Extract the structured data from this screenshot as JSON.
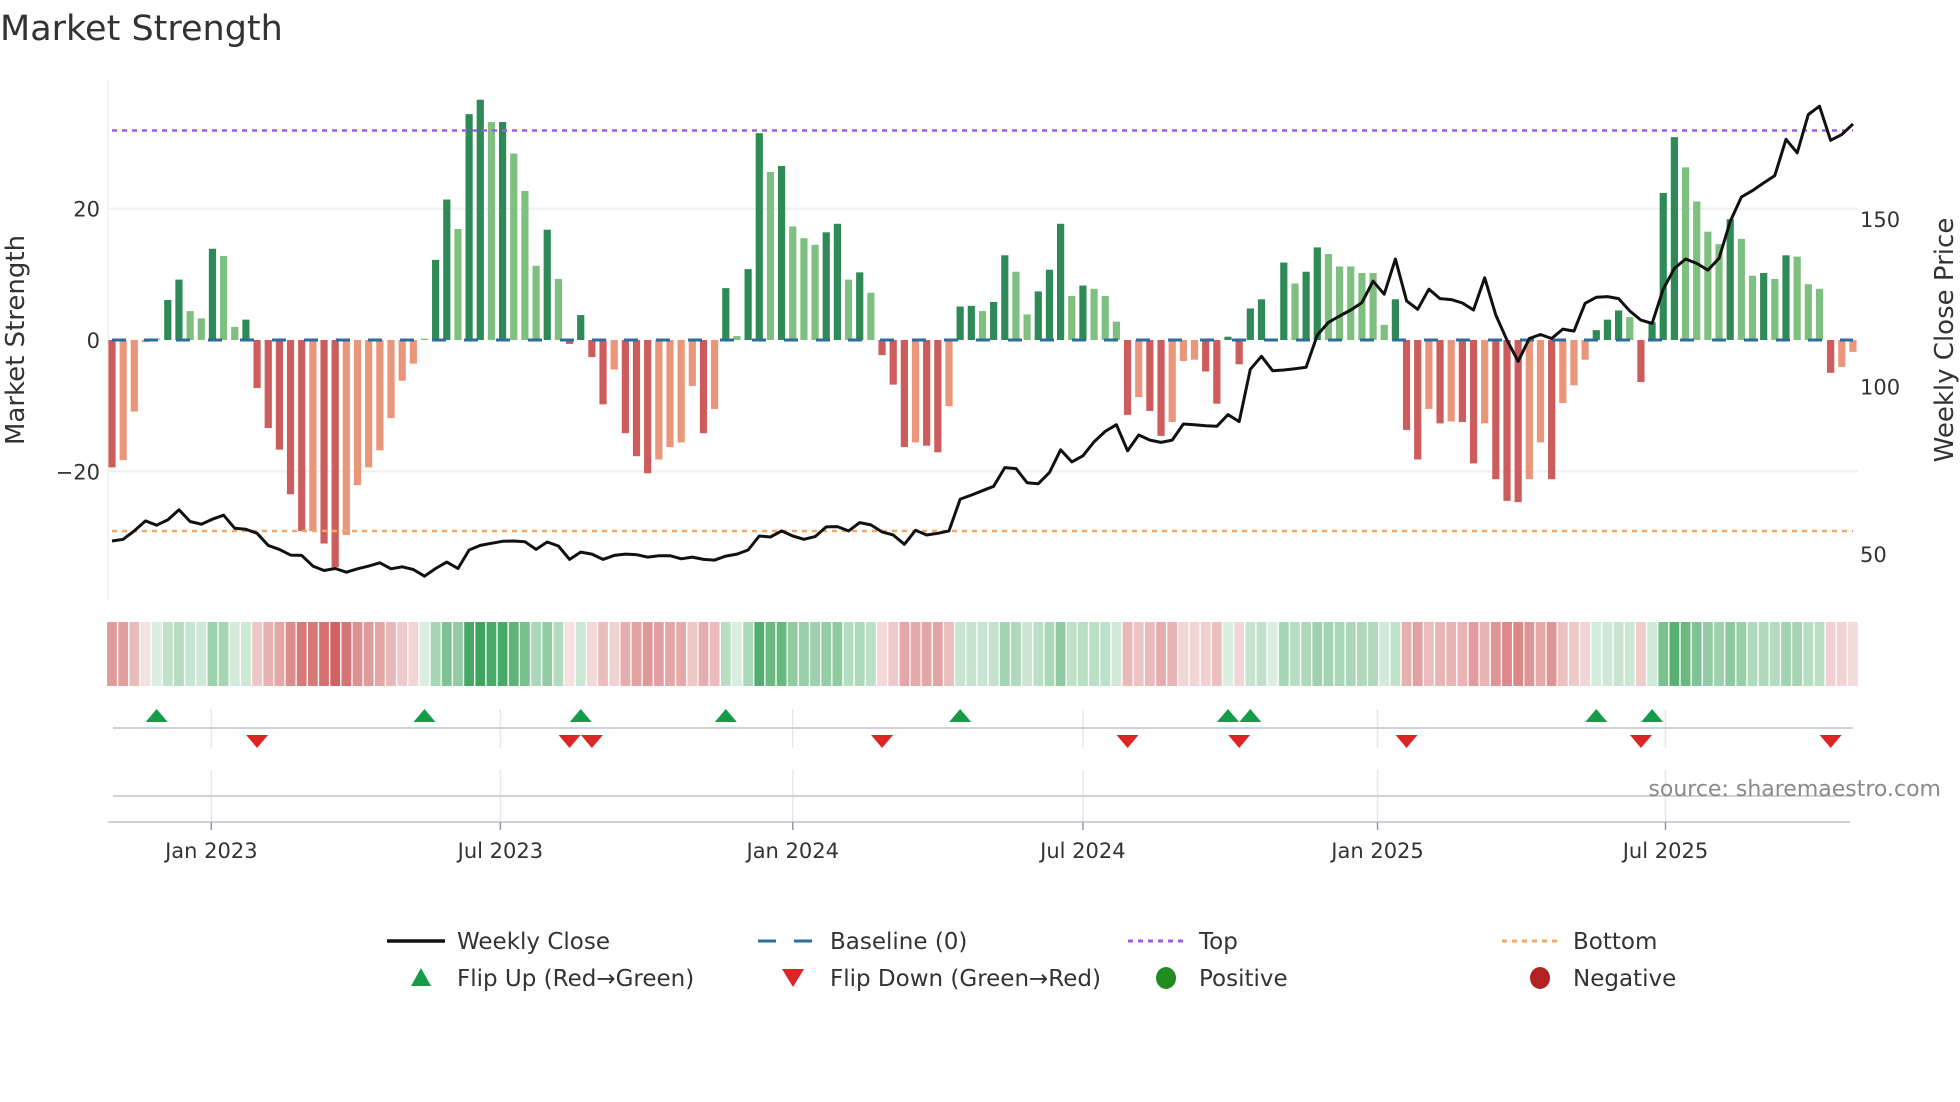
{
  "title": "Market Strength",
  "source": "source: sharemaestro.com",
  "chart_data": {
    "type": "bar",
    "title": "Market Strength",
    "ylabel": "Market Strength",
    "y2label": "Weekly Close Price",
    "ylim": [
      -39.6,
      39.6
    ],
    "y2lim": [
      36.3,
      191.4
    ],
    "y_ticks": [
      {
        "v": 20,
        "label": "20"
      },
      {
        "v": 0,
        "label": "0"
      },
      {
        "v": -20,
        "label": "−20"
      }
    ],
    "y2_ticks": [
      {
        "v": 150,
        "label": "150"
      },
      {
        "v": 100,
        "label": "100"
      },
      {
        "v": 50,
        "label": "50"
      }
    ],
    "x_ticks": [
      {
        "week": 8.9,
        "label": "Jan 2023"
      },
      {
        "week": 34.8,
        "label": "Jul 2023"
      },
      {
        "week": 61.0,
        "label": "Jan 2024"
      },
      {
        "week": 87.0,
        "label": "Jul 2024"
      },
      {
        "week": 113.4,
        "label": "Jan 2025"
      },
      {
        "week": 139.2,
        "label": "Jul 2025"
      }
    ],
    "top": 31.9,
    "bottom": -29.1,
    "baseline": 0,
    "strength": [
      -19.4,
      -18.3,
      -10.9,
      -0.3,
      0.2,
      6.1,
      9.2,
      4.4,
      3.3,
      13.9,
      12.8,
      2.0,
      3.1,
      -7.3,
      -13.4,
      -16.7,
      -23.5,
      -29.1,
      -29.1,
      -31.0,
      -34.6,
      -29.7,
      -22.1,
      -19.4,
      -16.8,
      -11.9,
      -6.2,
      -3.6,
      0.2,
      12.2,
      21.4,
      16.9,
      34.4,
      36.6,
      33.2,
      33.2,
      28.4,
      22.7,
      11.3,
      16.8,
      9.3,
      -0.6,
      3.8,
      -2.6,
      -9.8,
      -4.5,
      -14.2,
      -17.7,
      -20.3,
      -18.2,
      -16.3,
      -15.6,
      -7.0,
      -14.2,
      -10.5,
      7.9,
      0.6,
      10.8,
      31.5,
      25.6,
      26.5,
      17.3,
      15.5,
      14.5,
      16.4,
      17.7,
      9.2,
      10.3,
      7.2,
      -2.3,
      -6.8,
      -16.3,
      -15.6,
      -16.1,
      -17.1,
      -10.1,
      5.1,
      5.2,
      4.4,
      5.8,
      12.9,
      10.4,
      3.9,
      7.4,
      10.7,
      17.7,
      6.7,
      8.3,
      7.8,
      6.7,
      2.8,
      -11.4,
      -8.7,
      -10.8,
      -14.6,
      -12.5,
      -3.2,
      -3.0,
      -4.8,
      -9.7,
      0.5,
      -3.7,
      4.8,
      6.2,
      0.2,
      11.8,
      8.6,
      10.4,
      14.1,
      13.1,
      11.2,
      11.2,
      10.2,
      10.2,
      2.3,
      6.2,
      -13.7,
      -18.2,
      -10.5,
      -12.7,
      -12.4,
      -12.5,
      -18.8,
      -12.7,
      -21.2,
      -24.5,
      -24.7,
      -21.2,
      -15.6,
      -21.2,
      -9.6,
      -6.9,
      -3.0,
      1.5,
      3.1,
      4.5,
      3.5,
      -6.4,
      2.7,
      22.4,
      30.9,
      26.3,
      21.1,
      16.5,
      14.6,
      18.4,
      15.4,
      9.8,
      10.2,
      9.3,
      12.9,
      12.7,
      8.5,
      7.8,
      -5.0,
      -4.1,
      -1.8
    ],
    "shade": "DLLLLDDLLDLLDDDDDDLDDLLLLLLLLDDLDDLDLLLDLDDDDLDDDLLLLDLDLDDLDLLLDDLDLDDDLDDLDDLDDLLDDDLDLLLDLDDLLLDDDDDDLDLDDLLLLLLDDDLDLDDLDDDLLDLLLDDDLDDDDLLLLDLLDLDLLLDLL",
    "weekly_close": [
      53.9,
      54.4,
      56.9,
      59.9,
      58.6,
      60.2,
      63.2,
      59.7,
      58.9,
      60.4,
      61.6,
      57.7,
      57.4,
      56.2,
      52.6,
      51.4,
      49.7,
      49.6,
      46.4,
      45.1,
      45.7,
      44.6,
      45.6,
      46.4,
      47.4,
      45.6,
      46.2,
      45.4,
      43.4,
      45.7,
      47.6,
      45.7,
      51.2,
      52.6,
      53.2,
      53.8,
      53.9,
      53.7,
      51.4,
      53.6,
      52.4,
      48.4,
      50.6,
      50.0,
      48.4,
      49.6,
      50.0,
      49.8,
      49.1,
      49.5,
      49.5,
      48.6,
      49.1,
      48.4,
      48.2,
      49.4,
      50.0,
      51.2,
      55.4,
      55.1,
      56.9,
      55.4,
      54.4,
      55.2,
      58.1,
      58.2,
      56.9,
      59.4,
      58.7,
      56.6,
      55.7,
      52.9,
      57.1,
      55.7,
      56.2,
      56.9,
      66.4,
      67.6,
      68.9,
      70.2,
      75.8,
      75.5,
      71.3,
      71.0,
      74.3,
      81.1,
      77.5,
      79.3,
      83.5,
      86.6,
      88.6,
      80.8,
      85.5,
      84.0,
      83.3,
      84.0,
      88.8,
      88.6,
      88.3,
      88.1,
      91.6,
      89.5,
      105.1,
      109.0,
      104.7,
      104.9,
      105.3,
      105.7,
      115.3,
      119.1,
      121.0,
      122.8,
      125.0,
      131.4,
      127.5,
      138.0,
      125.5,
      123.0,
      129.0,
      126.2,
      125.9,
      124.9,
      122.8,
      132.4,
      121.3,
      113.8,
      107.5,
      114.3,
      115.5,
      114.3,
      117.1,
      116.5,
      124.8,
      126.6,
      126.8,
      126.2,
      122.5,
      119.8,
      118.8,
      129.0,
      135.2,
      138.0,
      136.7,
      134.7,
      138.2,
      149.2,
      156.5,
      158.4,
      160.7,
      162.9,
      173.7,
      169.7,
      181.1,
      183.6,
      173.4,
      175.1,
      178.3
    ],
    "flip_up_weeks": [
      4,
      28,
      42,
      55,
      76,
      100,
      102,
      133,
      138
    ],
    "flip_down_weeks": [
      13,
      41,
      43,
      69,
      91,
      101,
      116,
      137,
      154
    ],
    "legend": [
      {
        "label": "Weekly Close",
        "symbol": "line",
        "color": "#111111"
      },
      {
        "label": "Baseline (0)",
        "symbol": "dash",
        "color": "#2c6e9b"
      },
      {
        "label": "Top",
        "symbol": "dot",
        "color": "#9b5fe0"
      },
      {
        "label": "Bottom",
        "symbol": "dot",
        "color": "#f0a868"
      },
      {
        "label": "Flip Up (Red→Green)",
        "symbol": "tri-up",
        "color": "#169c48"
      },
      {
        "label": "Flip Down (Green→Red)",
        "symbol": "tri-down",
        "color": "#dc2626"
      },
      {
        "label": "Positive",
        "symbol": "circle",
        "color": "#228b22"
      },
      {
        "label": "Negative",
        "symbol": "circle",
        "color": "#b22222"
      }
    ],
    "colors": {
      "pos_dark": "#2e8b57",
      "pos_light": "#7fbf7f",
      "neg_dark": "#cd5c5c",
      "neg_light": "#e9967a",
      "strip_pos": "#3aa35a",
      "strip_neg": "#cd5c5c"
    }
  }
}
